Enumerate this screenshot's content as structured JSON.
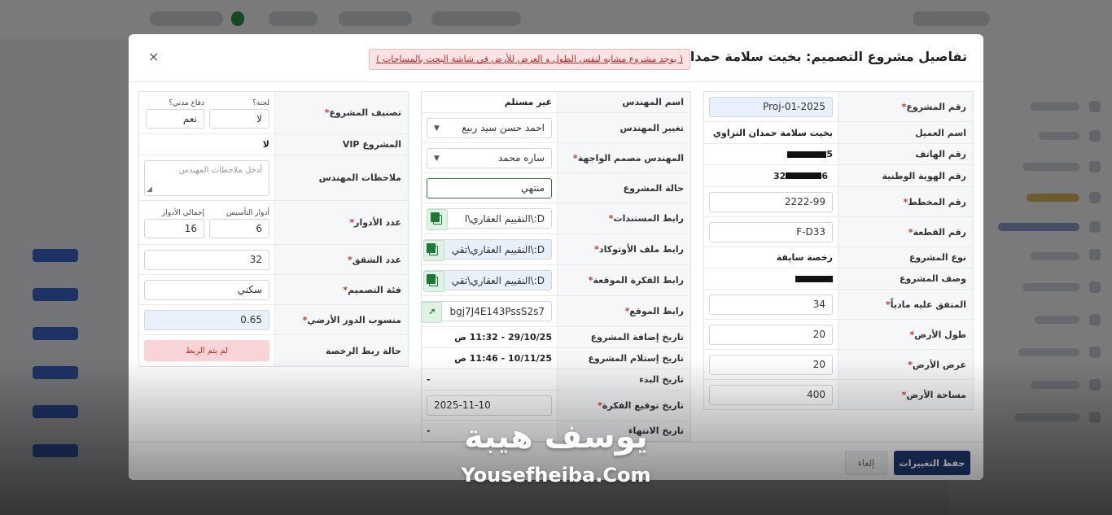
{
  "modal": {
    "title": "تفاصيل مشروع التصميم: بخيت سلامة حمدان النزاوي",
    "warning": "( يوجد مشروع مشابه لنفس الطول و العرض للأرض في شاشة البحث بالمساحات )",
    "close_symbol": "×"
  },
  "right": {
    "project_no": {
      "label": "رقم المشروع",
      "value": "Proj-01-2025"
    },
    "client_name": {
      "label": "اسم العميل",
      "value": "بخيت سلامة حمدان النزاوي"
    },
    "phone": {
      "label": "رقم الهاتف",
      "value_start": "5"
    },
    "national_id": {
      "label": "رقم الهوية الوطنية",
      "value_start": "32",
      "value_end": "6"
    },
    "plan_no": {
      "label": "رقم المخطط",
      "value": "2222-99"
    },
    "plot_no": {
      "label": "رقم القطعة",
      "value": "F-D33"
    },
    "project_type": {
      "label": "نوع المشروع",
      "value": "رخصة سابقة"
    },
    "project_desc": {
      "label": "وصف المشروع"
    },
    "agreed_amount": {
      "label": "المتفق عليه مادياً",
      "value": "34"
    },
    "land_length": {
      "label": "طول الأرض",
      "value": "20"
    },
    "land_width": {
      "label": "عرض الأرض",
      "value": "20"
    },
    "land_area": {
      "label": "مساحة الأرض",
      "value": "400"
    }
  },
  "middle": {
    "engineer_name": {
      "label": "اسم المهندس",
      "value": "غير مستلم"
    },
    "change_engineer": {
      "label": "تغيير المهندس",
      "value": "احمد حسن سيد ربيع"
    },
    "facade_engineer": {
      "label": "المهندس مصمم الواجهة",
      "value": "ساره محمد"
    },
    "project_status": {
      "label": "حالة المشروع",
      "value": "منتهي"
    },
    "docs_link": {
      "label": "رابط المستندات",
      "value": "D:\\النقييم العقاري\\ا"
    },
    "autocad_link": {
      "label": "رابط ملف الأوتوكاد",
      "value": "D:\\النقييم العقاري\\تقي"
    },
    "idea_link": {
      "label": "رابط الفكرة الموقعة",
      "value": "D:\\النقييم العقاري\\تقي"
    },
    "site_link": {
      "label": "رابط الموقع",
      "value": "bgj7J4E143PssS2s7"
    },
    "added_date": {
      "label": "تاريخ إضافة المشروع",
      "value": "29/10/25 - 11:32 ص"
    },
    "received_date": {
      "label": "تاريخ إستلام المشروع",
      "value": "10/11/25 - 11:46 ص"
    },
    "start_date": {
      "label": "تاريخ البدء",
      "value": "-"
    },
    "idea_sign_date": {
      "label": "تاريخ توقيع الفكرة",
      "value": "2025-11-10"
    },
    "end_date": {
      "label": "تاريخ الانتهاء",
      "value": "-"
    }
  },
  "left": {
    "classification": {
      "label": "تصنيف المشروع",
      "committee_label": "لجنة؟",
      "committee_value": "لا",
      "civil_defense_label": "دفاع مدني؟",
      "civil_defense_value": "نعم"
    },
    "vip": {
      "label": "المشروع VIP",
      "value": "لا"
    },
    "engineer_notes": {
      "label": "ملاحظات المهندس",
      "placeholder": "أدخل ملاحظات المهندس"
    },
    "floors": {
      "label": "عدد الأدوار",
      "foundation_label": "أدوار التأسيس",
      "foundation_value": "6",
      "total_label": "إجمالي الأدوار",
      "total_value": "16"
    },
    "apartments": {
      "label": "عدد الشقق",
      "value": "32"
    },
    "design_category": {
      "label": "فئة التصميم",
      "value": "سكني"
    },
    "ground_ratio": {
      "label": "منسوب الدور الأرضي",
      "value": "0.65"
    },
    "license_status": {
      "label": "حالة ربط الرخصة",
      "value": "لم يتم الربط"
    }
  },
  "footer": {
    "save_label": "حفظ التغييرات",
    "cancel_label": "إلغاء"
  },
  "watermark": {
    "arabic": "يوسف هيبة",
    "latin": "Yousefheiba.Com"
  },
  "colors": {
    "primary": "#1e3a6e",
    "danger": "#c62828",
    "success": "#2e7d32",
    "input_highlight": "#e8f0fb"
  }
}
